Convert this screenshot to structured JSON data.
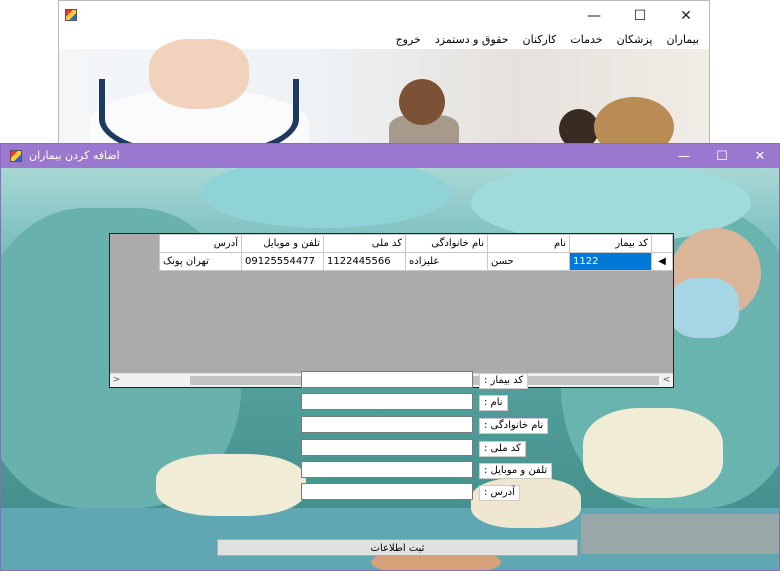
{
  "main_window": {
    "menu": [
      "بیماران",
      "پزشکان",
      "خدمات",
      "کارکنان",
      "حقوق و دستمزد",
      "خروج"
    ],
    "controls": {
      "minimize": "—",
      "maximize": "☐",
      "close": "✕"
    }
  },
  "dialog": {
    "title": "اضافه کردن بیماران",
    "controls": {
      "minimize": "—",
      "maximize": "☐",
      "close": "✕"
    }
  },
  "grid": {
    "columns": [
      "کد بیمار",
      "نام",
      "نام خانوادگی",
      "کد ملی",
      "تلفن و موبایل",
      "آدرس"
    ],
    "rows": [
      {
        "indicator": "◀",
        "cells": [
          "1122",
          "حسن",
          "علیزاده",
          "1122445566",
          "09125554477",
          "تهران پونک"
        ]
      }
    ],
    "scroll_left": "<",
    "scroll_right": ">"
  },
  "form": {
    "fields": [
      {
        "label": "کد بیمار :",
        "value": ""
      },
      {
        "label": "نام :",
        "value": ""
      },
      {
        "label": "نام خانوادگی :",
        "value": ""
      },
      {
        "label": "کد ملی :",
        "value": ""
      },
      {
        "label": "تلفن و موبایل :",
        "value": ""
      },
      {
        "label": "آدرس :",
        "value": ""
      }
    ],
    "submit_label": "ثبت اطلاعات"
  },
  "colors": {
    "dialog_titlebar": "#9a78cf",
    "selected_cell": "#0078d7"
  }
}
